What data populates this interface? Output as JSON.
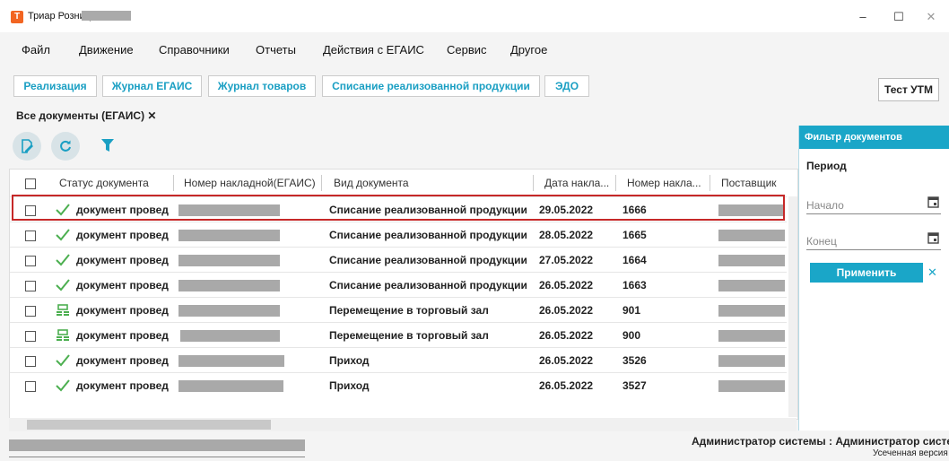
{
  "window": {
    "title": "Триар Розница",
    "app_icon": "Т"
  },
  "menu": [
    "Файл",
    "Движение",
    "Справочники",
    "Отчеты",
    "Действия с ЕГАИС",
    "Сервис",
    "Другое"
  ],
  "toolbar": {
    "buttons": [
      "Реализация",
      "Журнал ЕГАИС",
      "Журнал товаров",
      "Списание реализованной продукции",
      "ЭДО"
    ],
    "test_utm": "Тест УТМ"
  },
  "tab": {
    "title": "Все документы (ЕГАИС) ✕"
  },
  "table": {
    "headers": [
      "Статус документа",
      "Номер накладной(ЕГАИС)",
      "Вид документа",
      "Дата накла...",
      "Номер накла...",
      "Поставщик"
    ],
    "rows": [
      {
        "status": "документ провед",
        "icon": "check-icon",
        "type": "Списание реализованной продукции",
        "date": "29.05.2022",
        "number": "1666"
      },
      {
        "status": "документ провед",
        "icon": "check-icon",
        "type": "Списание реализованной продукции",
        "date": "28.05.2022",
        "number": "1665"
      },
      {
        "status": "документ провед",
        "icon": "check-icon",
        "type": "Списание реализованной продукции",
        "date": "27.05.2022",
        "number": "1664"
      },
      {
        "status": "документ провед",
        "icon": "check-icon",
        "type": "Списание реализованной продукции",
        "date": "26.05.2022",
        "number": "1663"
      },
      {
        "status": "документ провед",
        "icon": "transfer-icon",
        "type": "Перемещение в торговый зал",
        "date": "26.05.2022",
        "number": "901"
      },
      {
        "status": "документ провед",
        "icon": "transfer-icon",
        "type": "Перемещение в торговый зал",
        "date": "26.05.2022",
        "number": "900"
      },
      {
        "status": "документ провед",
        "icon": "check-icon",
        "type": "Приход",
        "date": "26.05.2022",
        "number": "3526"
      },
      {
        "status": "документ провед",
        "icon": "check-icon",
        "type": "Приход",
        "date": "26.05.2022",
        "number": "3527"
      }
    ]
  },
  "filter": {
    "title": "Фильтр документов",
    "period": "Период",
    "start_label": "Начало",
    "end_label": "Конец",
    "apply": "Применить",
    "clear": "✕"
  },
  "footer": {
    "user": "Администратор системы : Администратор системы",
    "version": "Усеченная версия"
  },
  "colors": {
    "accent": "#1aa6c8",
    "highlight": "#c62828",
    "check": "#4caf50"
  }
}
